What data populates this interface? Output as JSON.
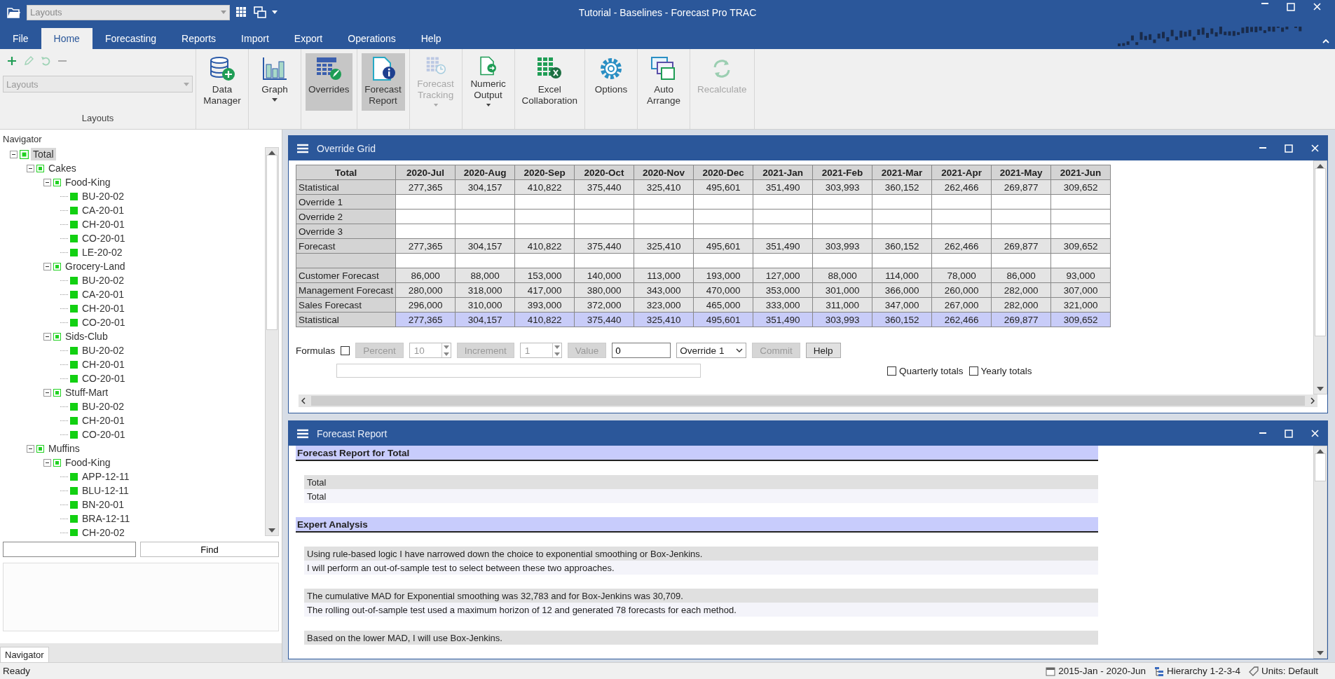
{
  "window": {
    "title": "Tutorial - Baselines - Forecast Pro TRAC",
    "layout_combo": "Layouts"
  },
  "tabs": [
    {
      "label": "File",
      "selected": false
    },
    {
      "label": "Home",
      "selected": true
    },
    {
      "label": "Forecasting",
      "selected": false
    },
    {
      "label": "Reports",
      "selected": false
    },
    {
      "label": "Import",
      "selected": false
    },
    {
      "label": "Export",
      "selected": false
    },
    {
      "label": "Operations",
      "selected": false
    },
    {
      "label": "Help",
      "selected": false
    }
  ],
  "ribbon": {
    "layouts": {
      "combo": "Layouts",
      "label": "Layouts"
    },
    "buttons": [
      {
        "label": "Data Manager",
        "kind": "database",
        "selected": false,
        "disabled": false,
        "dropdown": false
      },
      {
        "label": "Graph",
        "kind": "chart",
        "selected": false,
        "disabled": false,
        "dropdown": true
      },
      {
        "label": "Overrides",
        "kind": "grid",
        "selected": true,
        "disabled": false,
        "dropdown": false
      },
      {
        "label": "Forecast Report",
        "kind": "report",
        "selected": true,
        "disabled": false,
        "dropdown": false
      },
      {
        "label": "Forecast Tracking",
        "kind": "tracking",
        "selected": false,
        "disabled": true,
        "dropdown": true
      },
      {
        "label": "Numeric Output",
        "kind": "export",
        "selected": false,
        "disabled": false,
        "dropdown": true
      },
      {
        "label": "Excel Collaboration",
        "kind": "spreadsheet",
        "selected": false,
        "disabled": false,
        "dropdown": false
      },
      {
        "label": "Options",
        "kind": "gear",
        "selected": false,
        "disabled": false,
        "dropdown": false
      },
      {
        "label": "Auto Arrange",
        "kind": "windows",
        "selected": false,
        "disabled": false,
        "dropdown": false
      },
      {
        "label": "Recalculate",
        "kind": "refresh",
        "selected": false,
        "disabled": true,
        "dropdown": false
      }
    ]
  },
  "navigator": {
    "title": "Navigator",
    "tab": "Navigator",
    "find_button": "Find",
    "tree": [
      {
        "label": "Total",
        "selected": true,
        "expanded": true,
        "children": [
          {
            "label": "Cakes",
            "selected": false,
            "expanded": true,
            "children": [
              {
                "label": "Food-King",
                "selected": false,
                "expanded": true,
                "children": [
                  {
                    "label": "BU-20-02",
                    "selected": false
                  },
                  {
                    "label": "CA-20-01",
                    "selected": false
                  },
                  {
                    "label": "CH-20-01",
                    "selected": false
                  },
                  {
                    "label": "CO-20-01",
                    "selected": false
                  },
                  {
                    "label": "LE-20-02",
                    "selected": false
                  }
                ]
              },
              {
                "label": "Grocery-Land",
                "selected": false,
                "expanded": true,
                "children": [
                  {
                    "label": "BU-20-02",
                    "selected": false
                  },
                  {
                    "label": "CA-20-01",
                    "selected": false
                  },
                  {
                    "label": "CH-20-01",
                    "selected": false
                  },
                  {
                    "label": "CO-20-01",
                    "selected": false
                  }
                ]
              },
              {
                "label": "Sids-Club",
                "selected": false,
                "expanded": true,
                "children": [
                  {
                    "label": "BU-20-02",
                    "selected": false
                  },
                  {
                    "label": "CH-20-01",
                    "selected": false
                  },
                  {
                    "label": "CO-20-01",
                    "selected": false
                  }
                ]
              },
              {
                "label": "Stuff-Mart",
                "selected": false,
                "expanded": true,
                "children": [
                  {
                    "label": "BU-20-02",
                    "selected": false
                  },
                  {
                    "label": "CH-20-01",
                    "selected": false
                  },
                  {
                    "label": "CO-20-01",
                    "selected": false
                  }
                ]
              }
            ]
          },
          {
            "label": "Muffins",
            "selected": false,
            "expanded": true,
            "children": [
              {
                "label": "Food-King",
                "selected": false,
                "expanded": true,
                "children": [
                  {
                    "label": "APP-12-11",
                    "selected": false
                  },
                  {
                    "label": "BLU-12-11",
                    "selected": false
                  },
                  {
                    "label": "BN-20-01",
                    "selected": false
                  },
                  {
                    "label": "BRA-12-11",
                    "selected": false
                  },
                  {
                    "label": "CH-20-02",
                    "selected": false
                  }
                ]
              }
            ]
          }
        ]
      }
    ]
  },
  "override_grid": {
    "title": "Override Grid",
    "corner": "Total",
    "columns": [
      "2020-Jul",
      "2020-Aug",
      "2020-Sep",
      "2020-Oct",
      "2020-Nov",
      "2020-Dec",
      "2021-Jan",
      "2021-Feb",
      "2021-Mar",
      "2021-Apr",
      "2021-May",
      "2021-Jun"
    ],
    "rows": [
      {
        "label": "Statistical",
        "kind": "data",
        "selected": false,
        "values": [
          "277,365",
          "304,157",
          "410,822",
          "375,440",
          "325,410",
          "495,601",
          "351,490",
          "303,993",
          "360,152",
          "262,466",
          "269,877",
          "309,652"
        ]
      },
      {
        "label": "Override 1",
        "kind": "input",
        "selected": false
      },
      {
        "label": "Override 2",
        "kind": "input",
        "selected": false
      },
      {
        "label": "Override 3",
        "kind": "input",
        "selected": false
      },
      {
        "label": "Forecast",
        "kind": "data",
        "selected": false,
        "values": [
          "277,365",
          "304,157",
          "410,822",
          "375,440",
          "325,410",
          "495,601",
          "351,490",
          "303,993",
          "360,152",
          "262,466",
          "269,877",
          "309,652"
        ]
      },
      {
        "kind": "blank",
        "selected": false
      },
      {
        "label": "Customer Forecast",
        "kind": "data",
        "selected": false,
        "values": [
          "86,000",
          "88,000",
          "153,000",
          "140,000",
          "113,000",
          "193,000",
          "127,000",
          "88,000",
          "114,000",
          "78,000",
          "86,000",
          "93,000"
        ]
      },
      {
        "label": "Management Forecast",
        "kind": "data",
        "selected": false,
        "values": [
          "280,000",
          "318,000",
          "417,000",
          "380,000",
          "343,000",
          "470,000",
          "353,000",
          "301,000",
          "366,000",
          "260,000",
          "282,000",
          "307,000"
        ]
      },
      {
        "label": "Sales Forecast",
        "kind": "data",
        "selected": false,
        "values": [
          "296,000",
          "310,000",
          "393,000",
          "372,000",
          "323,000",
          "465,000",
          "333,000",
          "311,000",
          "347,000",
          "267,000",
          "282,000",
          "321,000"
        ]
      },
      {
        "label": "Statistical",
        "kind": "data",
        "selected": true,
        "values": [
          "277,365",
          "304,157",
          "410,822",
          "375,440",
          "325,410",
          "495,601",
          "351,490",
          "303,993",
          "360,152",
          "262,466",
          "269,877",
          "309,652"
        ]
      }
    ],
    "controls": {
      "formulas": {
        "label": "Formulas",
        "checked": false
      },
      "percent": {
        "label": "Percent",
        "disabled": true
      },
      "percent_step": "10",
      "increment": {
        "label": "Increment",
        "disabled": true
      },
      "increment_step": "1",
      "value_button": {
        "label": "Value",
        "disabled": true
      },
      "value": "0",
      "target": "Override 1",
      "commit": {
        "label": "Commit",
        "disabled": true
      },
      "help": {
        "label": "Help",
        "disabled": false
      },
      "quarterly_totals": {
        "label": "Quarterly totals",
        "checked": false
      },
      "yearly_totals": {
        "label": "Yearly totals",
        "checked": false
      }
    }
  },
  "report": {
    "title": "Forecast Report",
    "sections": [
      {
        "heading": "Forecast Report for Total",
        "groups": [
          [
            "Total",
            "Total"
          ]
        ]
      },
      {
        "heading": "Expert Analysis",
        "groups": [
          [
            "Using rule-based logic I have narrowed down the choice to exponential smoothing or Box-Jenkins.",
            "I will perform an out-of-sample test to select between these two approaches."
          ],
          [
            "The cumulative MAD for Exponential smoothing was 32,783 and for Box-Jenkins was 30,709.",
            "The rolling out-of-sample test used a maximum horizon of 12 and generated 78 forecasts for each method."
          ],
          [
            "Based on the lower MAD, I will use Box-Jenkins."
          ]
        ]
      }
    ]
  },
  "status_bar": {
    "text": "Ready",
    "date_range": "2015-Jan - 2020-Jun",
    "hierarchy": "Hierarchy 1-2-3-4",
    "units": "Units: Default"
  }
}
